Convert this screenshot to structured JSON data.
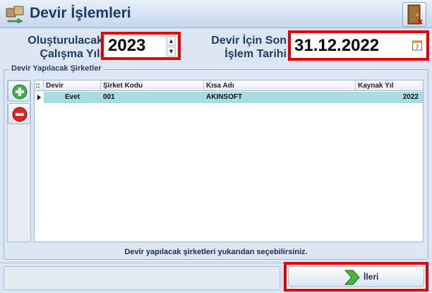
{
  "window": {
    "title": "Devir İşlemleri",
    "app_icon": "folder-transfer-icon",
    "exit_icon": "door-exit-icon"
  },
  "form": {
    "year_label_line1": "Oluşturulacak",
    "year_label_line2": "Çalışma Yılı",
    "year_value": "2023",
    "date_label_line1": "Devir İçin Son",
    "date_label_line2": "İşlem Tarihi",
    "date_value": "31.12.2022",
    "date_icon": "calendar-icon",
    "date_icon_text": "7"
  },
  "group": {
    "title": "Devir Yapılacak Şirketler",
    "add_icon": "add-icon",
    "remove_icon": "remove-icon",
    "columns": {
      "marker": "::",
      "devir": "Devir",
      "sirket_kodu": "Şirket Kodu",
      "kisa_adi": "Kısa Adı",
      "kaynak_yil": "Kaynak Yıl"
    },
    "rows": [
      {
        "devir": "Evet",
        "sirket_kodu": "001",
        "kisa_adi": "AKINSOFT",
        "kaynak_yil": "2022"
      }
    ],
    "hint": "Devir yapılacak şirketleri yukarıdan seçebilirsiniz."
  },
  "footer": {
    "next_label": "İleri",
    "next_icon": "arrow-right-icon"
  },
  "colors": {
    "highlight": "#e60000",
    "selected_row": "#a8dce4",
    "title": "#1c3b6b"
  }
}
